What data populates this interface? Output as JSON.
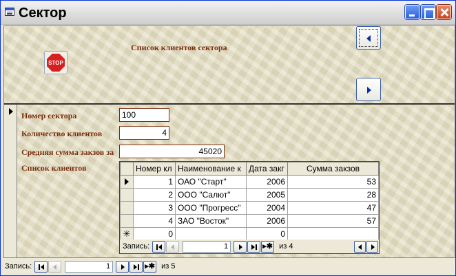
{
  "window": {
    "title": "Сектор"
  },
  "header": {
    "title": "Список клиентов сектора",
    "stop_label": "STOP"
  },
  "fields": {
    "sector_label": "Номер сектора",
    "sector_value": "100",
    "count_label": "Количество клиентов",
    "count_value": "4",
    "avg_label": "Средняя сумма закзов за",
    "avg_value": "45020",
    "list_label": "Список клиентов"
  },
  "subform": {
    "columns": [
      "Номер кл",
      "Наименование к",
      "Дата закг",
      "Сумма закзов"
    ],
    "rows": [
      [
        "1",
        "ОАО \"Старт\"",
        "2006",
        "53"
      ],
      [
        "2",
        "ООО \"Салют\"",
        "2005",
        "28"
      ],
      [
        "3",
        "ООО \"Прогресс\"",
        "2004",
        "47"
      ],
      [
        "4",
        "ЗАО \"Восток\"",
        "2006",
        "57"
      ]
    ],
    "new_row": [
      "0",
      "",
      "0",
      ""
    ],
    "nav": {
      "label": "Запись:",
      "current": "1",
      "of_text": "из  4"
    }
  },
  "main_nav": {
    "label": "Запись:",
    "current": "1",
    "of_text": "из  5"
  }
}
